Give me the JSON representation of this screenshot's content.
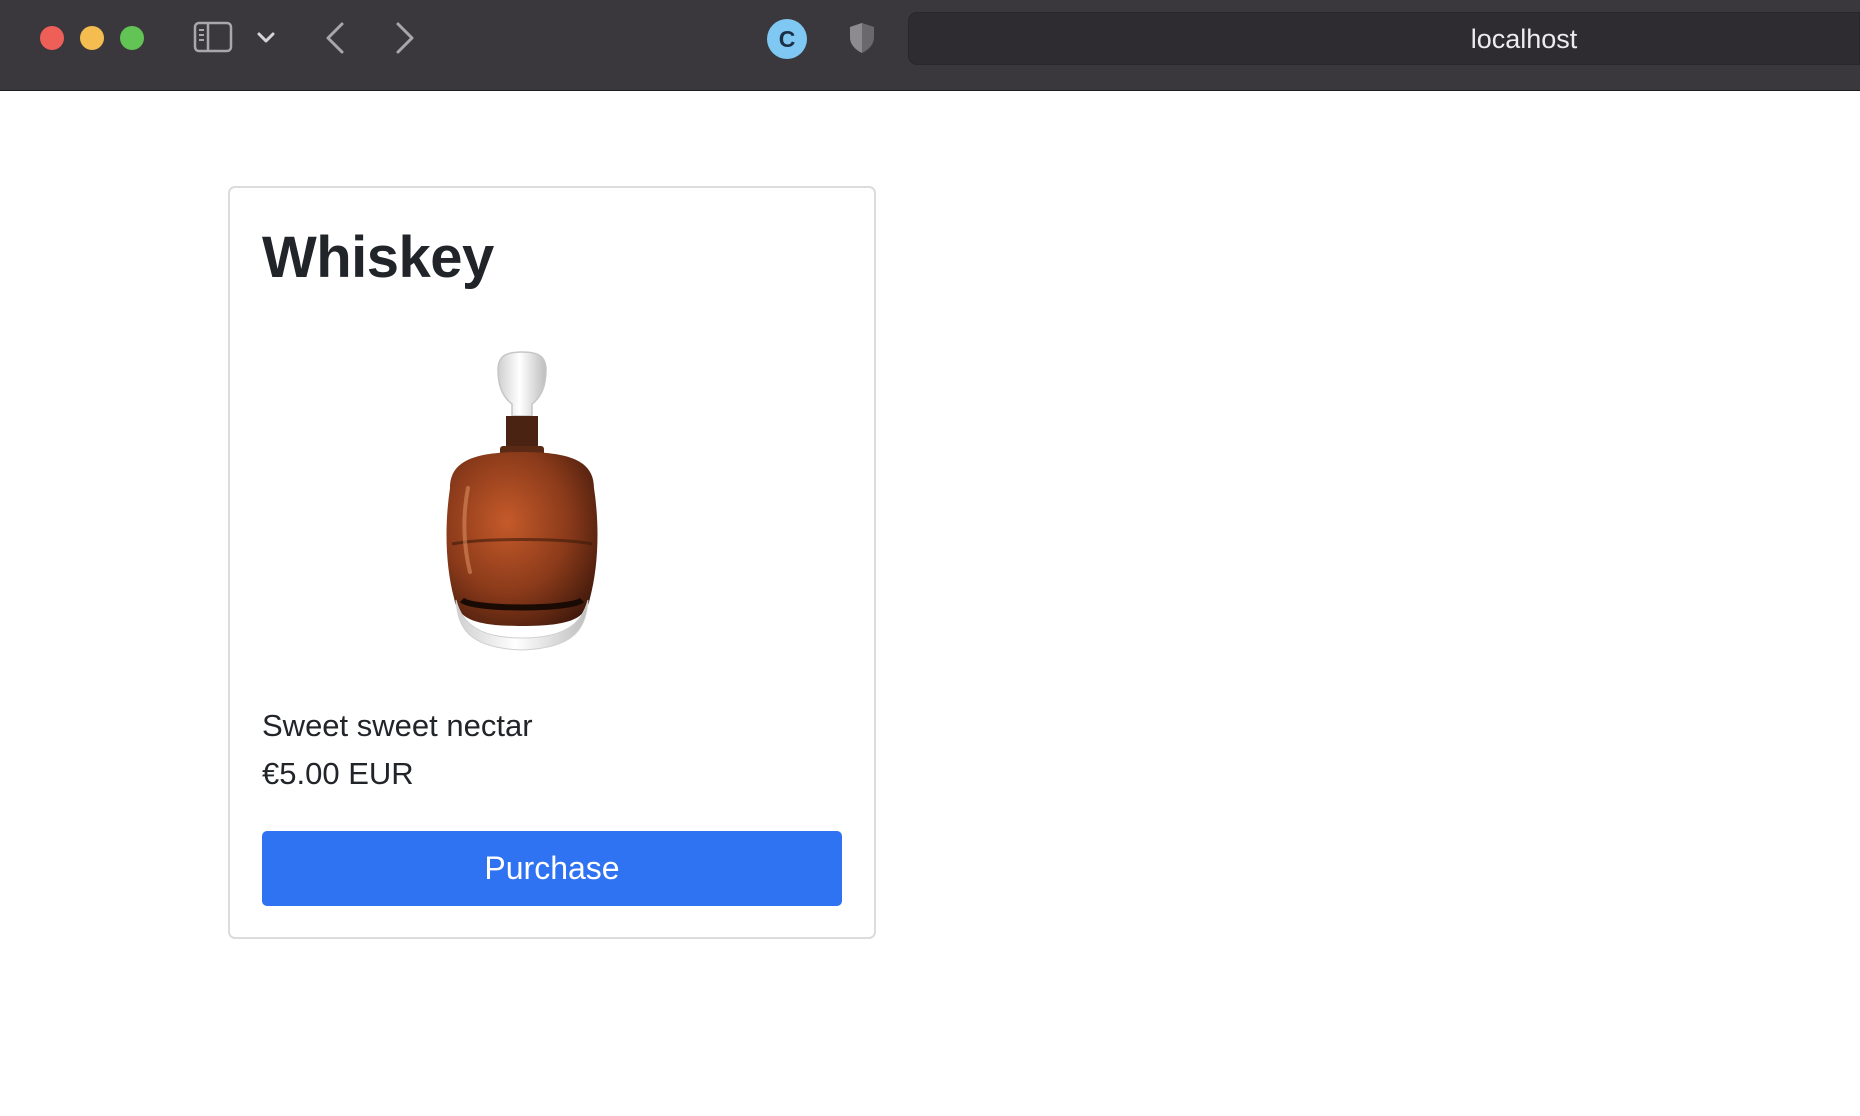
{
  "browser": {
    "address": "localhost",
    "extension_icon_letter": "C"
  },
  "product": {
    "title": "Whiskey",
    "description": "Sweet sweet nectar",
    "price": "€5.00 EUR",
    "purchase_label": "Purchase"
  },
  "colors": {
    "toolbar_bg": "#3a383d",
    "button_primary": "#2f72f2",
    "traffic_close": "#ee5f57",
    "traffic_minimize": "#f5bd4f",
    "traffic_maximize": "#61c454"
  }
}
